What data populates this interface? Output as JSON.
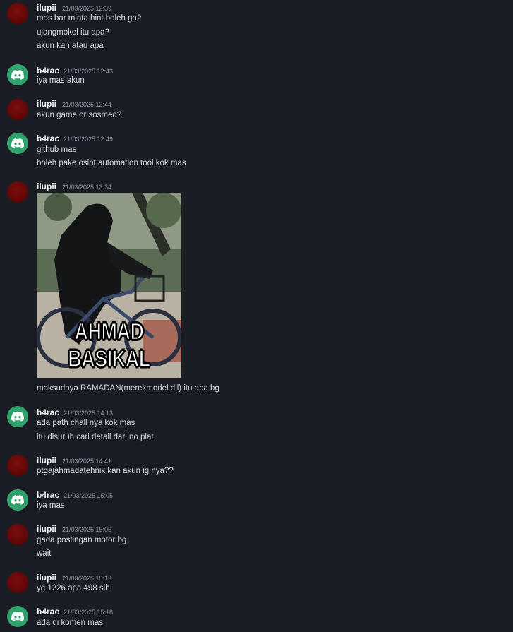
{
  "messages": [
    {
      "user": "ilupii",
      "avatar": "red",
      "time": "21/03/2025 12:39",
      "lines": [
        "mas bar minta hint boleh ga?",
        "ujangmokel itu apa?",
        "akun kah atau apa"
      ]
    },
    {
      "user": "b4rac",
      "avatar": "discord",
      "time": "21/03/2025 12:43",
      "lines": [
        "iya mas akun"
      ]
    },
    {
      "user": "ilupii",
      "avatar": "red",
      "time": "21/03/2025 12:44",
      "lines": [
        "akun game or sosmed?"
      ]
    },
    {
      "user": "b4rac",
      "avatar": "discord",
      "time": "21/03/2025 12:49",
      "lines": [
        "github mas",
        "boleh pake osint automation tool kok mas"
      ]
    },
    {
      "user": "ilupii",
      "avatar": "red",
      "time": "21/03/2025 13:34",
      "gif_caption": "AHMAD BASIKAL",
      "lines": [
        "maksudnya RAMADAN(merekmodel dll) itu apa bg"
      ]
    },
    {
      "user": "b4rac",
      "avatar": "discord",
      "time": "21/03/2025 14:13",
      "lines": [
        "ada path chall nya kok mas",
        "itu disuruh cari detail dari no plat"
      ]
    },
    {
      "user": "ilupii",
      "avatar": "red",
      "time": "21/03/2025 14:41",
      "lines": [
        "ptgajahmadatehnik kan akun ig nya??"
      ]
    },
    {
      "user": "b4rac",
      "avatar": "discord",
      "time": "21/03/2025 15:05",
      "lines": [
        "iya mas"
      ]
    },
    {
      "user": "ilupii",
      "avatar": "red",
      "time": "21/03/2025 15:05",
      "lines": [
        "gada postingan motor bg",
        "wait"
      ]
    },
    {
      "user": "ilupii",
      "avatar": "red",
      "time": "21/03/2025 15:13",
      "lines": [
        "yg 1226 apa 498 sih"
      ]
    },
    {
      "user": "b4rac",
      "avatar": "discord",
      "time": "21/03/2025 15:18",
      "lines": [
        "ada di komen mas"
      ]
    }
  ]
}
